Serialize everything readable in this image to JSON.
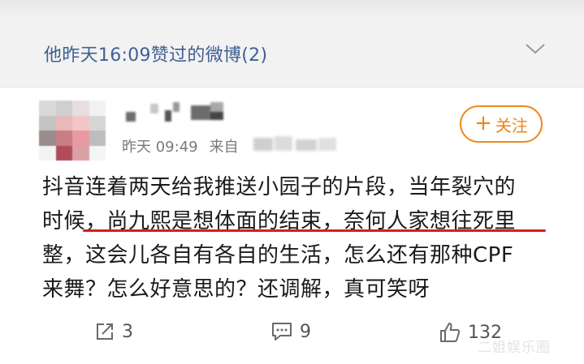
{
  "liked_header": {
    "text": "他昨天16:09赞过的微博(2)"
  },
  "post": {
    "author_name": "",
    "time": "昨天 09:49",
    "source_prefix": "来自",
    "follow_button": {
      "plus": "+",
      "label": "关注"
    },
    "lines": [
      "抖音连着两天给我推送小园子的片段，当年裂穴的",
      "时候，尚九熙是想体面的结束，奈何人家想往死里",
      "整，这会儿各自有各自的生活，怎么还有那种CPF",
      "来舞？怎么好意思的？还调解，真可笑呀"
    ]
  },
  "actions": {
    "repost_count": "3",
    "comment_count": "9",
    "like_count": "132"
  },
  "watermark": "二姐娱乐圈",
  "colors": {
    "header_link": "#3f5f95",
    "follow_orange": "#ef8a1d",
    "underline_red": "#d91d1d"
  },
  "icons": [
    "chevron-down-icon",
    "plus-icon",
    "repost-icon",
    "comment-icon",
    "like-icon"
  ]
}
